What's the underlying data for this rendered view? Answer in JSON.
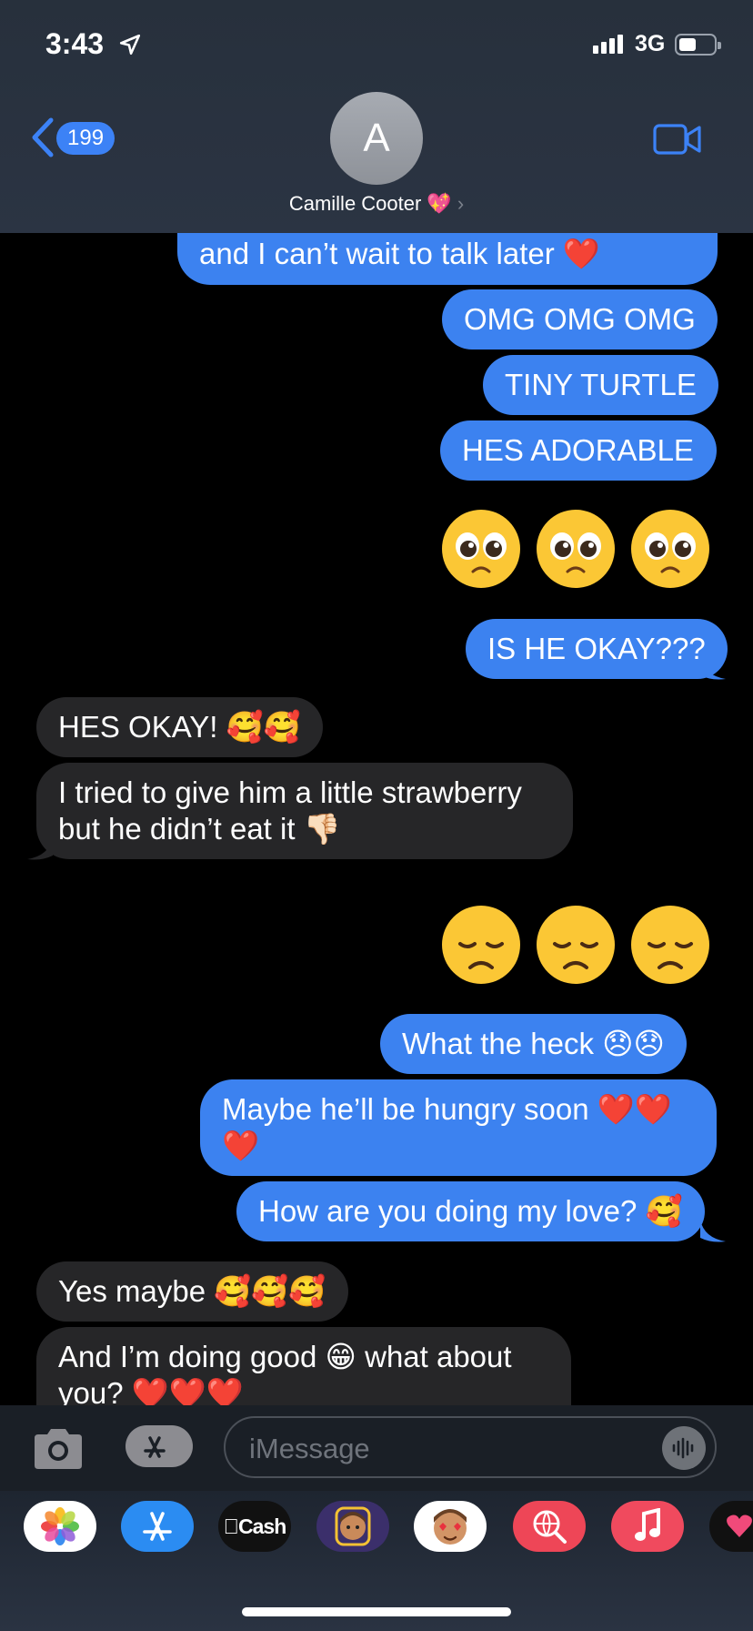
{
  "status_bar": {
    "time": "3:43",
    "network": "3G",
    "battery_level": 0.35,
    "signal_bars": 4
  },
  "header": {
    "back_badge": "199",
    "avatar_initial": "A",
    "contact_name": "Camille Cooter 💖",
    "contact_chevron": "›"
  },
  "messages": {
    "m1": "and I can’t wait to talk later ❤️",
    "m2": "OMG OMG OMG",
    "m3": "TINY TURTLE",
    "m4": "HES ADORABLE",
    "m5": "IS HE OKAY???",
    "m6": "HES OKAY! 🥰🥰",
    "m7": "I tried to give him a little strawberry but he didn’t eat it 👎🏻",
    "m8": "What the heck 😞😞",
    "m9": "Maybe he’ll be hungry soon ❤️❤️❤️",
    "m10": "How are you doing my love? 🥰",
    "m11": "Yes maybe 🥰🥰🥰",
    "m12": "And I’m doing good 😁 what about you? ❤️❤️❤️"
  },
  "big_emoji_rows": [
    {
      "name": "pleading-face",
      "count": 3
    },
    {
      "name": "disappointed-face",
      "count": 3
    }
  ],
  "input": {
    "placeholder": "iMessage"
  },
  "tray": {
    "apps": [
      "photos-icon",
      "app-store-icon",
      "apple-cash",
      "memoji-sticker",
      "animoji",
      "web-search-icon",
      "music-icon",
      "digital-touch-icon"
    ],
    "cash_label": "Cash"
  },
  "colors": {
    "outgoing_bubble": "#3c82f0",
    "incoming_bubble": "#262628",
    "accent": "#3c82f6"
  }
}
